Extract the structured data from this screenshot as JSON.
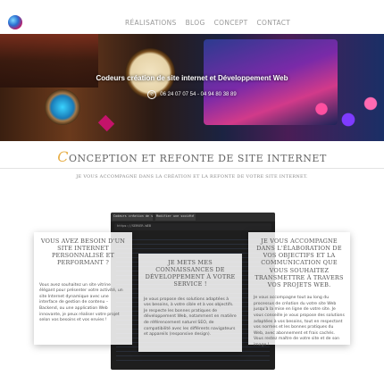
{
  "nav": {
    "items": [
      "RÉALISATIONS",
      "BLOG",
      "CONCEPT",
      "CONTACT"
    ]
  },
  "hero": {
    "title": "Codeurs création de site internet et Développement Web",
    "phone": "06 24 07 07 54 - 04 94 80 38 89",
    "phone_icon": "phone-icon"
  },
  "section": {
    "title_initial": "C",
    "title_rest": "ONCEPTION ET REFONTE DE SITE INTERNET",
    "subtitle": "JE VOUS ACCOMPAGNE DANS LA CRÉATION ET LA REFONTE DE VOTRE SITE INTERNET."
  },
  "screen": {
    "tab1": "Codeurs création de site int",
    "tab2": "Modifier une société",
    "url": "https://SERVER-WEB"
  },
  "cards": [
    {
      "title": "VOUS AVEZ BESOIN D'UN SITE INTERNET PERSONNALISÉ ET PERFORMANT ?",
      "text": "Vous avez souhaitez un site vitrine élégant pour présenter votre activité, un site Internet dynamique avec une interface de gestion de contenu – Backend, ou une application Web innovante, je peux réaliser votre projet selon vos besoins et vos envies !"
    },
    {
      "title": "JE METS MES CONNAISSANCES DE DÉVELOPPEMENT À VOTRE SERVICE !",
      "text": "Je vous propose des solutions adaptées à vos besoins, à votre cible et à vos objectifs. Je respecte les bonnes pratiques de développement Web, notamment en matière de référencement naturel SEO, de compatibilité avec les différents navigateurs et appareils (responsive design)."
    },
    {
      "title": "JE VOUS ACCOMPAGNE DANS L'ÉLABORATION DE VOS OBJECTIFS ET LA COMMUNICATION QUE VOUS SOUHAITEZ TRANSMETTRE À TRAVERS VOS PROJETS WEB.",
      "text": "Je vous accompagne tout au long du processus de création du votre site Web jusqu'à la mise en ligne de votre site. Je vous conseille je vous propose des solutions adaptées à vos besoins, tout en respectant vos normes et les bonnes pratiques du Web, avec abonnement et frais cachés. Vous restez maître de votre site et de son image !"
    }
  ]
}
